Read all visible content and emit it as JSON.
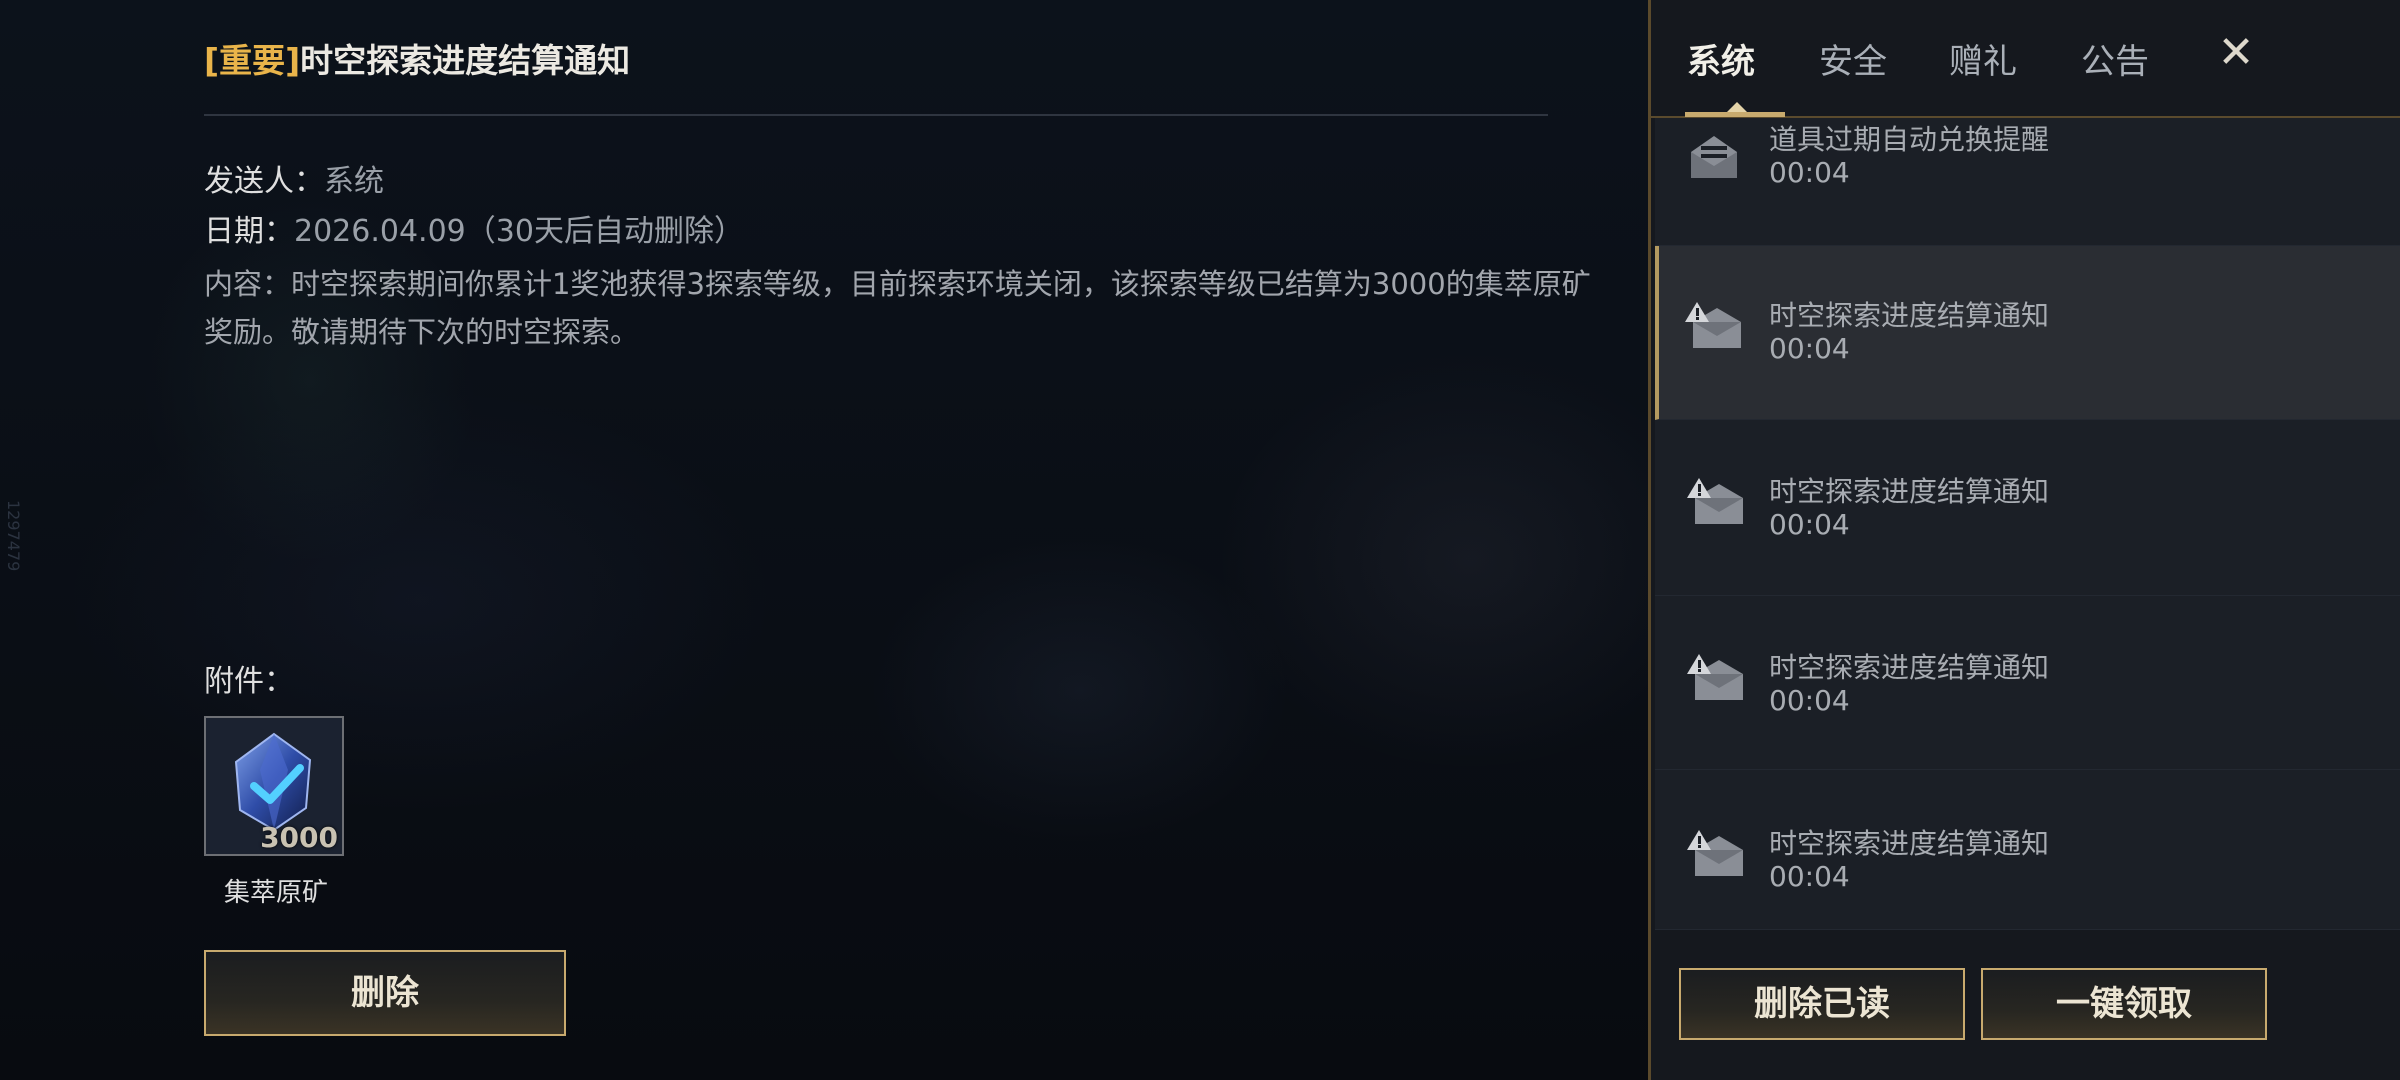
{
  "side_id": "1297479",
  "detail": {
    "tag": "[重要]",
    "title": "时空探索进度结算通知",
    "sender_label": "发送人：",
    "sender_value": "系统",
    "date_label": "日期：",
    "date_value": "2026.04.09（30天后自动删除）",
    "content": "内容：时空探索期间你累计1奖池获得3探索等级，目前探索环境关闭，该探索等级已结算为3000的集萃原矿奖励。敬请期待下次的时空探索。",
    "attachment_label": "附件：",
    "attachment": {
      "name": "集萃原矿",
      "count": "3000",
      "icon": "crystal-ore-icon"
    },
    "delete_button": "删除"
  },
  "tabs": [
    {
      "label": "系统",
      "active": true
    },
    {
      "label": "安全",
      "active": false
    },
    {
      "label": "赠礼",
      "active": false
    },
    {
      "label": "公告",
      "active": false
    }
  ],
  "close_icon": "✕",
  "mails": [
    {
      "title": "道具过期自动兑换提醒",
      "time": "00:04",
      "icon": "mail-read-icon",
      "selected": false
    },
    {
      "title": "时空探索进度结算通知",
      "time": "00:04",
      "icon": "important-mail-icon",
      "selected": true
    },
    {
      "title": "时空探索进度结算通知",
      "time": "00:04",
      "icon": "important-mail-icon",
      "selected": false
    },
    {
      "title": "时空探索进度结算通知",
      "time": "00:04",
      "icon": "important-mail-icon",
      "selected": false
    },
    {
      "title": "时空探索进度结算通知",
      "time": "00:04",
      "icon": "important-mail-icon",
      "selected": false
    }
  ],
  "footer": {
    "delete_read": "删除已读",
    "claim_all": "一键领取"
  },
  "colors": {
    "important": "#e9b44a",
    "gold_border": "#c8aa6e",
    "panel_bg": "#15181e"
  }
}
